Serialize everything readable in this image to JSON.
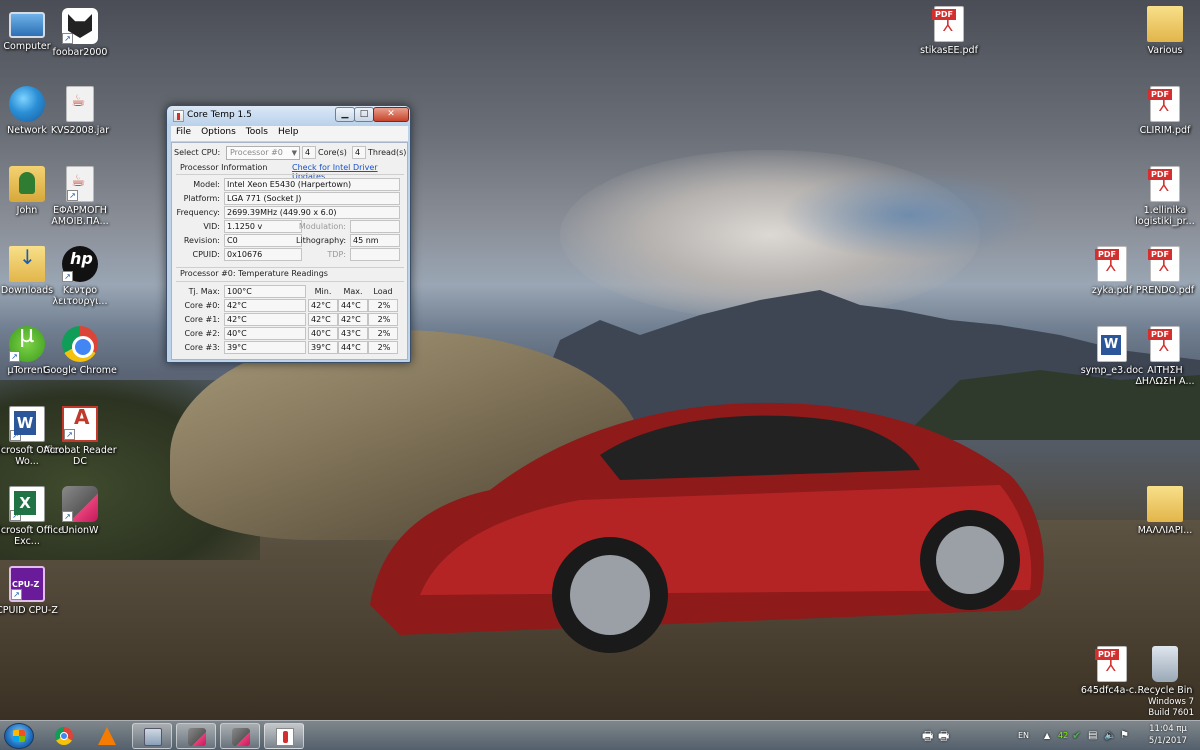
{
  "desktop": {
    "left_icons": [
      {
        "label": "Computer",
        "icon": "computer-icon"
      },
      {
        "label": "foobar2000",
        "icon": "foobar-icon"
      },
      {
        "label": "Network",
        "icon": "network-icon"
      },
      {
        "label": "KVS2008.jar",
        "icon": "jar-file-icon"
      },
      {
        "label": "John",
        "icon": "user-folder-icon"
      },
      {
        "label": "ΕΦΑΡΜΟΓΗ ΑΜΟΙΒ.ΠΑ...",
        "icon": "jar-file-icon"
      },
      {
        "label": "Downloads",
        "icon": "downloads-folder-icon"
      },
      {
        "label": "Κεντρο λειτουργι...",
        "icon": "hp-icon"
      },
      {
        "label": "µTorrent",
        "icon": "utorrent-icon"
      },
      {
        "label": "Google Chrome",
        "icon": "chrome-icon"
      },
      {
        "label": "Microsoft Office Wo...",
        "icon": "word-icon"
      },
      {
        "label": "Acrobat Reader DC",
        "icon": "acrobat-icon"
      },
      {
        "label": "Microsoft Office Exc...",
        "icon": "excel-icon"
      },
      {
        "label": "UnionW",
        "icon": "unionw-icon"
      },
      {
        "label": "CPUID CPU-Z",
        "icon": "cpuz-icon"
      }
    ],
    "right_icons": [
      {
        "label": "stikasEE.pdf",
        "icon": "pdf-file-icon"
      },
      {
        "label": "Various",
        "icon": "folder-icon"
      },
      {
        "label": "CLIRIM.pdf",
        "icon": "pdf-file-icon"
      },
      {
        "label": "1.ellinika logistiki_pr...",
        "icon": "pdf-file-icon"
      },
      {
        "label": "zyka.pdf",
        "icon": "pdf-file-icon"
      },
      {
        "label": "PRENDO.pdf",
        "icon": "pdf-file-icon"
      },
      {
        "label": "symp_e3.doc",
        "icon": "doc-file-icon"
      },
      {
        "label": "ΑΙΤΗΣΗ ΔΗΛΩΣΗ Α...",
        "icon": "pdf-file-icon"
      },
      {
        "label": "ΜΑΛΛΙΑΡΙ...",
        "icon": "folder-icon"
      },
      {
        "label": "645dfc4a-c...",
        "icon": "pdf-file-icon"
      },
      {
        "label": "Recycle Bin",
        "icon": "recycle-bin-icon"
      }
    ]
  },
  "coretemp": {
    "title": "Core Temp 1.5",
    "menu": [
      "File",
      "Options",
      "Tools",
      "Help"
    ],
    "select_cpu_label": "Select CPU:",
    "select_cpu_value": "Processor #0",
    "cores_value": "4",
    "cores_label": "Core(s)",
    "threads_value": "4",
    "threads_label": "Thread(s)",
    "proc_info_title": "Processor Information",
    "driver_link": "Check for Intel Driver Updates",
    "model_label": "Model:",
    "model_value": "Intel Xeon E5430 (Harpertown)",
    "platform_label": "Platform:",
    "platform_value": "LGA 771 (Socket J)",
    "frequency_label": "Frequency:",
    "frequency_value": "2699.39MHz (449.90 x 6.0)",
    "vid_label": "VID:",
    "vid_value": "1.1250 v",
    "modulation_label": "Modulation:",
    "revision_label": "Revision:",
    "revision_value": "C0",
    "lithography_label": "Lithography:",
    "lithography_value": "45 nm",
    "cpuid_label": "CPUID:",
    "cpuid_value": "0x10676",
    "tdp_label": "TDP:",
    "temps_title": "Processor #0: Temperature Readings",
    "tjmax_label": "Tj. Max:",
    "tjmax_value": "100°C",
    "col_min": "Min.",
    "col_max": "Max.",
    "col_load": "Load",
    "cores": [
      {
        "label": "Core #0:",
        "temp": "42°C",
        "min": "42°C",
        "max": "44°C",
        "load": "2%"
      },
      {
        "label": "Core #1:",
        "temp": "42°C",
        "min": "42°C",
        "max": "42°C",
        "load": "2%"
      },
      {
        "label": "Core #2:",
        "temp": "40°C",
        "min": "40°C",
        "max": "43°C",
        "load": "2%"
      },
      {
        "label": "Core #3:",
        "temp": "39°C",
        "min": "39°C",
        "max": "44°C",
        "load": "2%"
      }
    ]
  },
  "taskbar": {
    "apps": [
      {
        "name": "chrome",
        "icon": "chrome-icon",
        "state": "pinned"
      },
      {
        "name": "vlc",
        "icon": "vlc-icon",
        "state": "pinned"
      },
      {
        "name": "calculator",
        "icon": "calculator-icon",
        "state": "open"
      },
      {
        "name": "unionw-1",
        "icon": "unionw-icon",
        "state": "open"
      },
      {
        "name": "unionw-2",
        "icon": "unionw-icon",
        "state": "open"
      },
      {
        "name": "coretemp",
        "icon": "coretemp-icon",
        "state": "active"
      }
    ],
    "language": "EN",
    "tray_temp": "42",
    "time": "11:04 πμ",
    "date": "5/1/2017"
  },
  "watermark": {
    "line1": "Windows 7",
    "line2": "Build 7601"
  }
}
